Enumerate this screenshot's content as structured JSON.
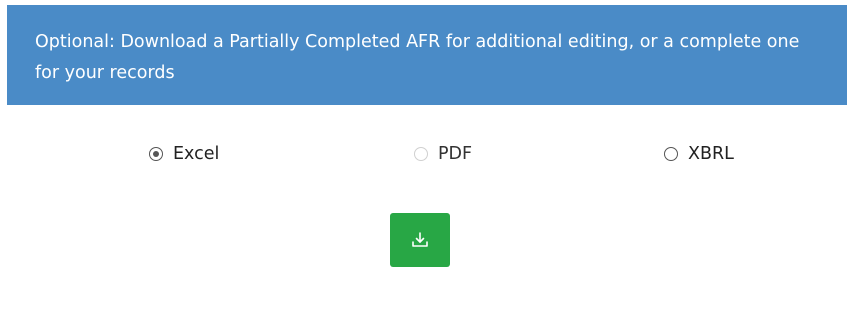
{
  "banner": {
    "text": "Optional: Download a Partially Completed AFR for additional editing, or a complete one for your records",
    "background_color": "#4a8bc7"
  },
  "format_options": [
    {
      "label": "Excel",
      "checked": true,
      "disabled": false
    },
    {
      "label": "PDF",
      "checked": false,
      "disabled": true
    },
    {
      "label": "XBRL",
      "checked": false,
      "disabled": false
    }
  ],
  "download_button": {
    "icon": "download-icon",
    "color": "#28a745"
  }
}
